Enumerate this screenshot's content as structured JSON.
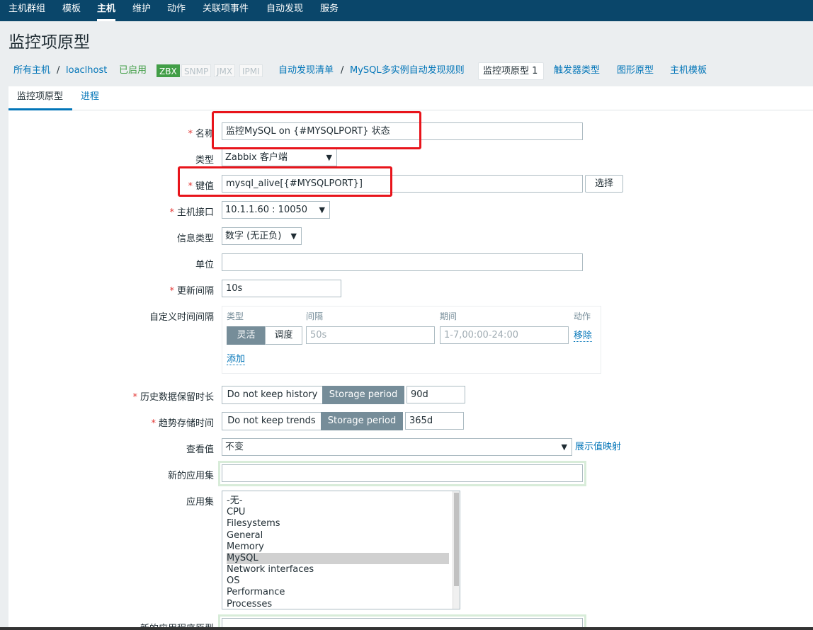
{
  "nav": {
    "items": [
      "主机群组",
      "模板",
      "主机",
      "维护",
      "动作",
      "关联项事件",
      "自动发现",
      "服务"
    ],
    "active_index": 2
  },
  "page": {
    "title": "监控项原型"
  },
  "breadcrumb": {
    "all_hosts": "所有主机",
    "sep": "/",
    "host": "loaclhost",
    "status": "已启用",
    "tags": [
      "ZBX",
      "SNMP",
      "JMX",
      "IPMI"
    ],
    "discovery_list": "自动发现清单",
    "discovery_rule": "MySQL多实例自动发现规则",
    "item_proto": "监控项原型 1",
    "trigger_proto": "触发器类型",
    "graph_proto": "图形原型",
    "host_template": "主机模板"
  },
  "tabs": {
    "item_proto": "监控项原型",
    "process": "进程"
  },
  "form": {
    "name": {
      "label": "名称",
      "value": "监控MySQL on {#MYSQLPORT} 状态"
    },
    "type": {
      "label": "类型",
      "value": "Zabbix 客户端"
    },
    "key": {
      "label": "键值",
      "value": "mysql_alive[{#MYSQLPORT}]",
      "button": "选择"
    },
    "interface": {
      "label": "主机接口",
      "value": "10.1.1.60 : 10050"
    },
    "info_type": {
      "label": "信息类型",
      "value": "数字 (无正负)"
    },
    "unit": {
      "label": "单位",
      "value": ""
    },
    "update_interval": {
      "label": "更新间隔",
      "value": "10s"
    },
    "custom_intervals": {
      "label": "自定义时间间隔",
      "headers": [
        "类型",
        "间隔",
        "期间",
        "动作"
      ],
      "mode_on": "灵活",
      "mode_off": "调度",
      "interval_placeholder": "50s",
      "period_placeholder": "1-7,00:00-24:00",
      "remove": "移除",
      "add": "添加"
    },
    "history": {
      "label": "历史数据保留时长",
      "opt_off": "Do not keep history",
      "opt_on": "Storage period",
      "value": "90d"
    },
    "trends": {
      "label": "趋势存储时间",
      "opt_off": "Do not keep trends",
      "opt_on": "Storage period",
      "value": "365d"
    },
    "show_value": {
      "label": "查看值",
      "value": "不变",
      "link": "展示值映射"
    },
    "new_app": {
      "label": "新的应用集",
      "value": ""
    },
    "apps": {
      "label": "应用集",
      "options": [
        "-无-",
        "CPU",
        "Filesystems",
        "General",
        "Memory",
        "MySQL",
        "Network interfaces",
        "OS",
        "Performance",
        "Processes"
      ],
      "selected": "MySQL"
    },
    "new_app_proto": {
      "label": "新的应用程序原型"
    }
  }
}
